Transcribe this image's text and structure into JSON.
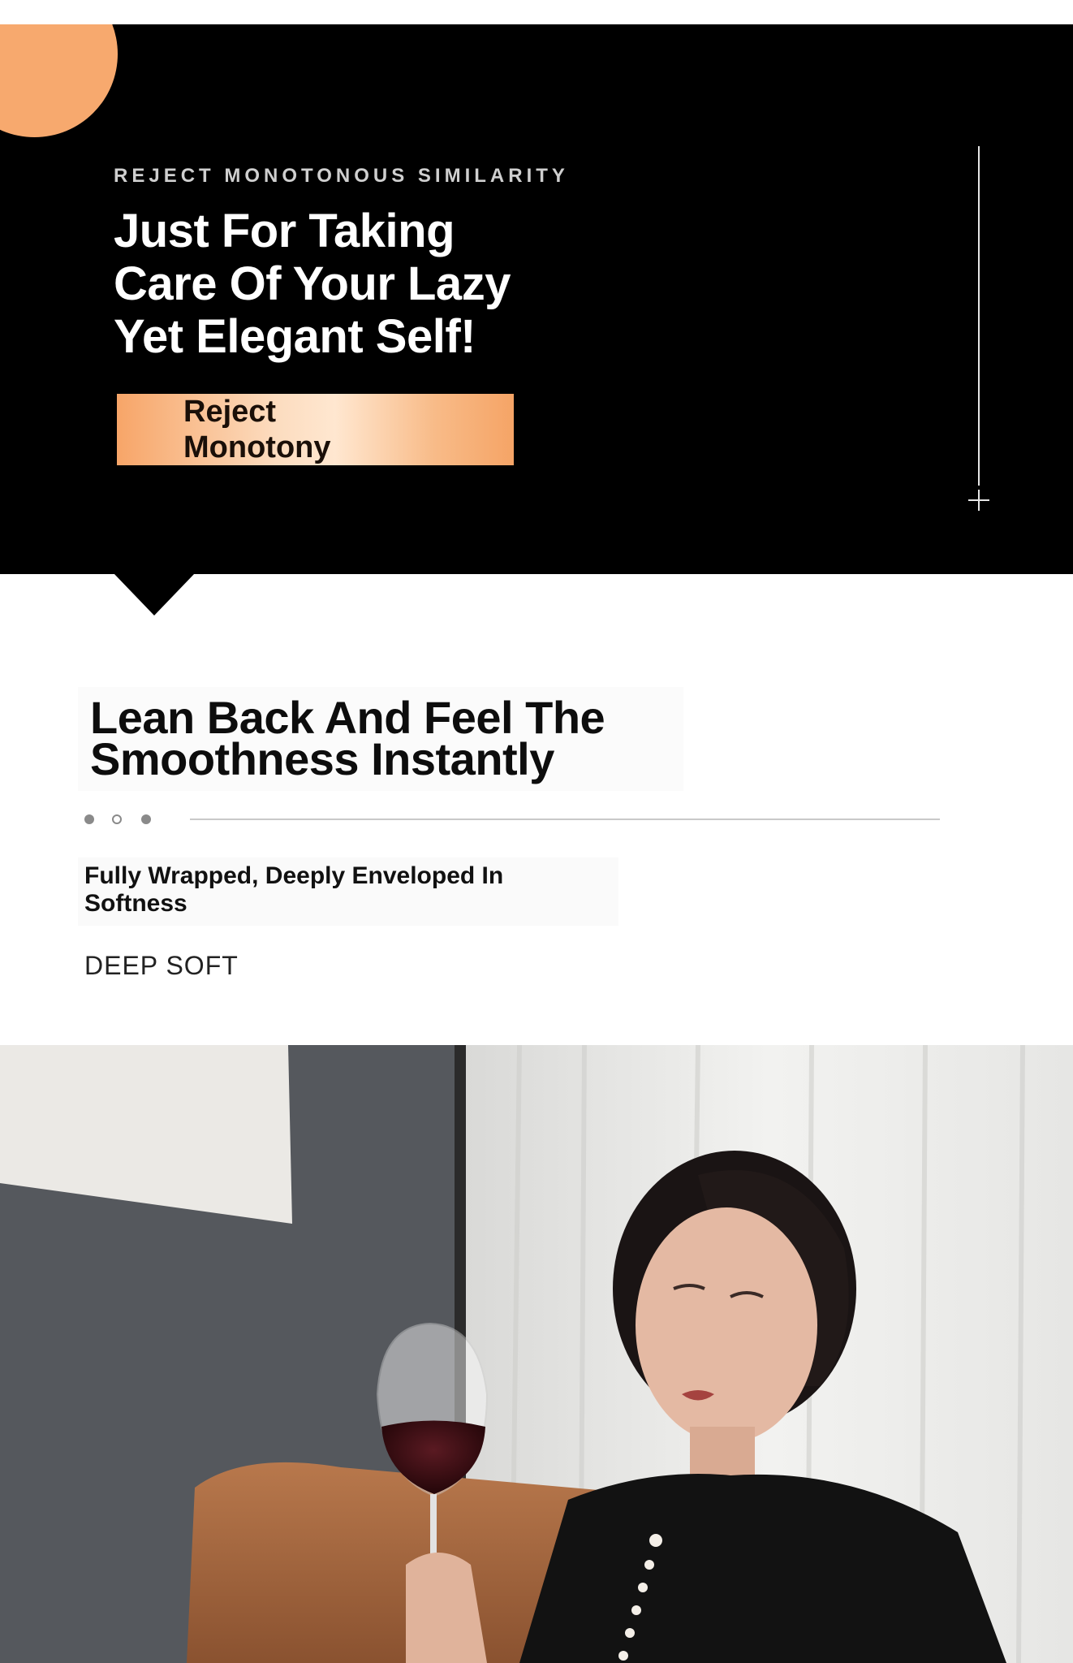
{
  "hero": {
    "eyebrow": "REJECT MONOTONOUS SIMILARITY",
    "title_lines": [
      "Just For Taking",
      "Care Of Your Lazy",
      "Yet Elegant Self!"
    ],
    "cta_lines": [
      "Reject",
      "Monotony"
    ]
  },
  "section": {
    "title_lines": [
      "Lean Back And Feel The",
      "Smoothness Instantly"
    ],
    "carousel": {
      "dot_count": 3,
      "active_index": 1
    },
    "subtitle_lines": [
      "Fully Wrapped, Deeply Enveloped In",
      "Softness"
    ],
    "tag": "DEEP SOFT"
  },
  "icons": {
    "plus": "plus-icon"
  },
  "colors": {
    "accent_orange": "#f7a96e",
    "hero_bg": "#000000"
  }
}
